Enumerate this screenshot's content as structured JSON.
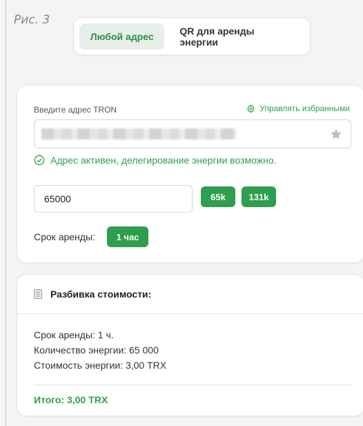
{
  "figure_label": "Рис. 3",
  "tabs": [
    {
      "label": "Любой адрес",
      "active": true
    },
    {
      "label": "QR для аренды энергии",
      "active": false
    }
  ],
  "address": {
    "label": "Введите адрес TRON",
    "manage_link": "Управлять избранными",
    "value_hidden": true,
    "status_text": "Адрес активен, делегирование энергии возможно."
  },
  "energy": {
    "value": "65000",
    "presets": [
      "65k",
      "131k"
    ]
  },
  "rental": {
    "label": "Срок аренды:",
    "option": "1 час"
  },
  "cost": {
    "title": "Разбивка стоимости:",
    "lines": [
      "Срок аренды: 1 ч.",
      "Количество энергии: 65 000",
      "Стоимость энергии: 3,00 TRX"
    ],
    "total": "Итого: 3,00 TRX"
  },
  "colors": {
    "accent": "#2f9e4e",
    "tab_active_bg": "#e8efe9"
  },
  "icons": [
    "gear-icon",
    "star-icon",
    "check-circle-icon",
    "document-icon"
  ]
}
